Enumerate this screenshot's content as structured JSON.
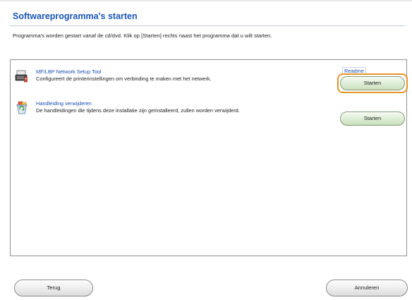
{
  "header": {
    "title": "Softwareprogramma's starten",
    "instruction": "Programma's worden gestart vanaf de cd/dvd. Klik op [Starten] rechts naast het programma dat u wilt starten."
  },
  "programs": [
    {
      "name": "MF/LBP Network Setup Tool",
      "description": "Configureert de printerinstellingen om verbinding te maken met het netwerk.",
      "readme_label": "Readme",
      "start_label": "Starten",
      "icon": "printer-network-icon"
    },
    {
      "name": "Handleiding verwijderen",
      "description": "De handleidingen die tijdens deze installatie zijn geïnstalleerd, zullen worden verwijderd.",
      "start_label": "Starten",
      "icon": "recycle-bin-icon"
    }
  ],
  "footer": {
    "back_label": "Terug",
    "cancel_label": "Annuleren"
  },
  "colors": {
    "title": "#1a57b5",
    "link": "#1a4fb0",
    "focus": "#e8932a",
    "start_button": "#d6e8cc"
  }
}
